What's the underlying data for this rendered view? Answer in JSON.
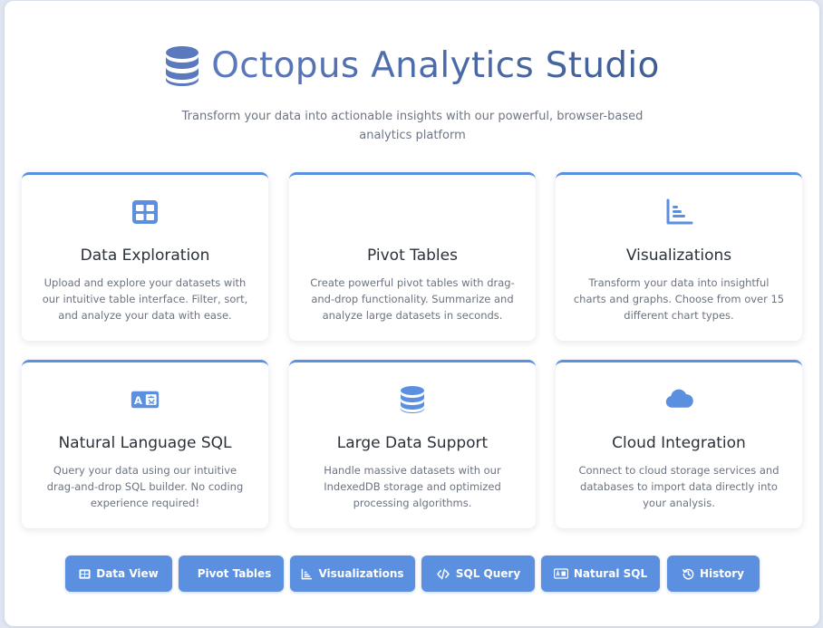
{
  "app": {
    "title": "Octopus Analytics Studio",
    "logo_icon": "database-icon",
    "subtitle": "Transform your data into actionable insights with our powerful, browser-based analytics platform"
  },
  "colors": {
    "accent": "#5b8fe0",
    "title_start": "#5b79bd",
    "title_end": "#3f5d94",
    "card_title": "#2b313a",
    "body_text": "#6b7380",
    "background": "#dfe5f1"
  },
  "features": [
    {
      "icon": "table-icon",
      "title": "Data Exploration",
      "description": "Upload and explore your datasets with our intuitive table interface. Filter, sort, and analyze your data with ease."
    },
    {
      "icon": "pivot-icon",
      "title": "Pivot Tables",
      "description": "Create powerful pivot tables with drag-and-drop functionality. Summarize and analyze large datasets in seconds."
    },
    {
      "icon": "bar-chart-icon",
      "title": "Visualizations",
      "description": "Transform your data into insightful charts and graphs. Choose from over 15 different chart types."
    },
    {
      "icon": "language-icon",
      "title": "Natural Language SQL",
      "description": "Query your data using our intuitive drag-and-drop SQL builder. No coding experience required!"
    },
    {
      "icon": "database-icon",
      "title": "Large Data Support",
      "description": "Handle massive datasets with our IndexedDB storage and optimized processing algorithms."
    },
    {
      "icon": "cloud-icon",
      "title": "Cloud Integration",
      "description": "Connect to cloud storage services and databases to import data directly into your analysis."
    }
  ],
  "nav": [
    {
      "icon": "table-icon",
      "label": "Data View"
    },
    {
      "icon": "pivot-icon",
      "label": "Pivot Tables"
    },
    {
      "icon": "bar-chart-icon",
      "label": "Visualizations"
    },
    {
      "icon": "code-icon",
      "label": "SQL Query"
    },
    {
      "icon": "language-icon",
      "label": "Natural SQL"
    },
    {
      "icon": "history-icon",
      "label": "History"
    }
  ]
}
